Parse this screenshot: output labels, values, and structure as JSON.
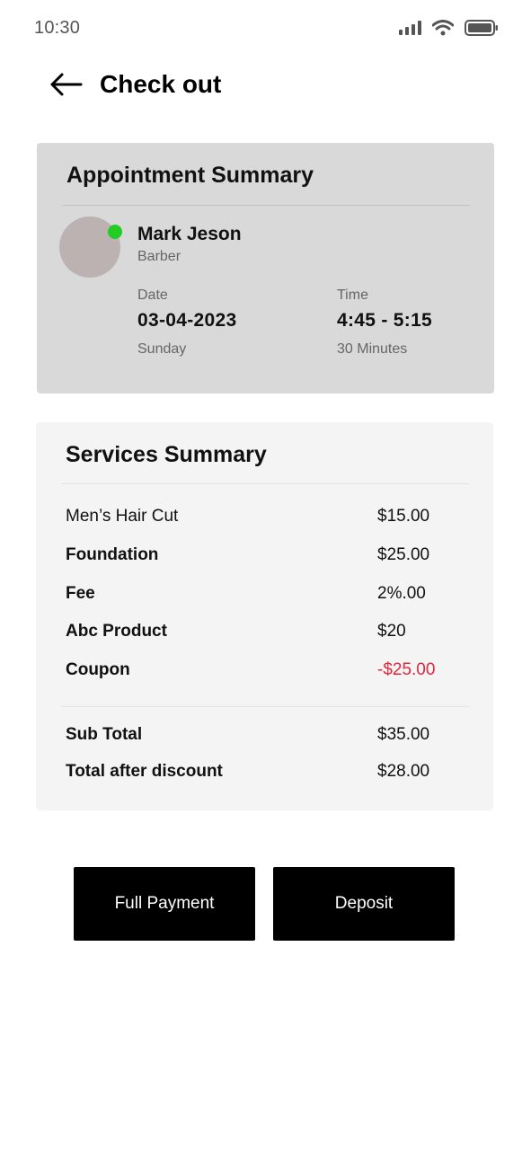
{
  "status_bar": {
    "time": "10:30",
    "icons": [
      "signal-icon",
      "wifi-icon",
      "battery-icon"
    ]
  },
  "header": {
    "back_icon": "arrow-left-icon",
    "title": "Check out"
  },
  "appointment": {
    "title": "Appointment Summary",
    "person": {
      "name": "Mark Jeson",
      "role": "Barber",
      "status": "online"
    },
    "date": {
      "label": "Date",
      "value": "03-04-2023",
      "sub": "Sunday"
    },
    "time": {
      "label": "Time",
      "value": "4:45 - 5:15",
      "sub": "30 Minutes"
    }
  },
  "services": {
    "title": "Services Summary",
    "items": [
      {
        "label": "Men’s Hair Cut",
        "value": "$15.00"
      },
      {
        "label": "Foundation",
        "value": "$25.00"
      },
      {
        "label": "Fee",
        "value": "2%.00"
      },
      {
        "label": "Abc Product",
        "value": "$20"
      },
      {
        "label": "Coupon",
        "value": "-$25.00"
      }
    ],
    "totals": [
      {
        "label": "Sub Total",
        "value": "$35.00"
      },
      {
        "label": "Total after discount",
        "value": "$28.00"
      }
    ]
  },
  "actions": {
    "full_payment": "Full Payment",
    "deposit": "Deposit"
  },
  "colors": {
    "discount": "#e0283c",
    "online": "#22cc22",
    "card_bg": "#d9d9d9",
    "button_bg": "#000000"
  }
}
